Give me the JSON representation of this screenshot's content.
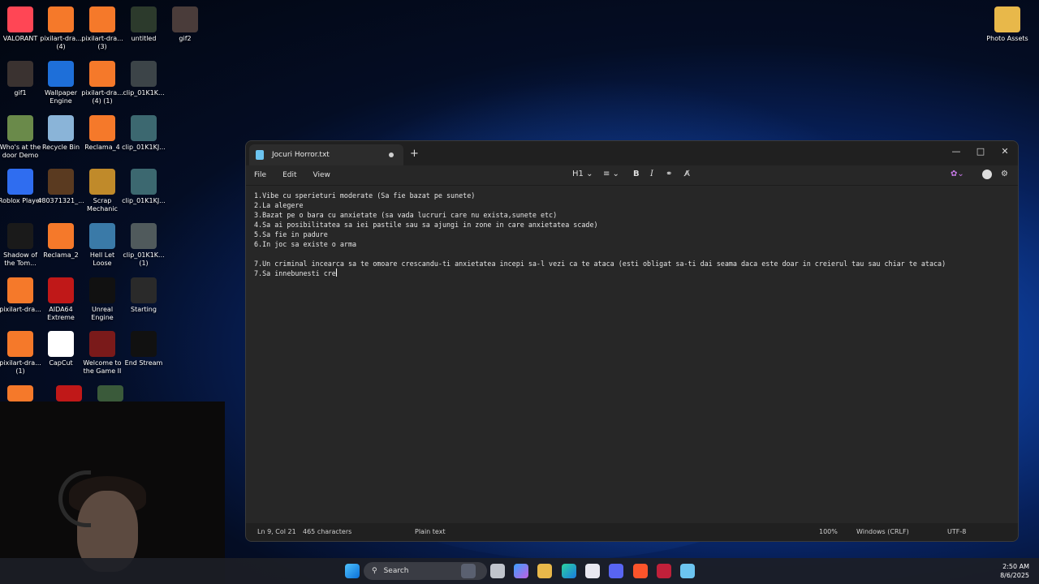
{
  "desktop": {
    "icons": [
      {
        "label": "VALORANT",
        "icon": "valorant-icon",
        "color": "#ff4655"
      },
      {
        "label": "pixilart-dra...\n(4)",
        "icon": "blender-icon",
        "color": "#f5792a"
      },
      {
        "label": "pixilart-dra...\n(3)",
        "icon": "blender-icon",
        "color": "#f5792a"
      },
      {
        "label": "untitled",
        "icon": "video-thumb-icon",
        "color": "#2c3a2c"
      },
      {
        "label": "gif2",
        "icon": "image-thumb-icon",
        "color": "#4a3c3a"
      },
      {
        "label": "gif1",
        "icon": "image-thumb-icon",
        "color": "#3a3230"
      },
      {
        "label": "Wallpaper\nEngine",
        "icon": "wallpaper-engine-icon",
        "color": "#1e6fd9"
      },
      {
        "label": "pixilart-dra...\n(4) (1)",
        "icon": "blender-icon",
        "color": "#f5792a"
      },
      {
        "label": "clip_01K1K...",
        "icon": "video-thumb-icon",
        "color": "#3c4448"
      },
      {
        "label": "Who's at the\ndoor Demo",
        "icon": "game-icon",
        "color": "#6a8a4a"
      },
      {
        "label": "Recycle Bin",
        "icon": "recycle-bin-icon",
        "color": "#8ab4d8"
      },
      {
        "label": "Reclama_4",
        "icon": "blender-icon",
        "color": "#f5792a"
      },
      {
        "label": "clip_01K1KJ...",
        "icon": "video-thumb-icon",
        "color": "#3c6870"
      },
      {
        "label": "Roblox Player",
        "icon": "roblox-icon",
        "color": "#2f6df0"
      },
      {
        "label": "480371321_...",
        "icon": "image-thumb-icon",
        "color": "#5a3a20"
      },
      {
        "label": "Scrap\nMechanic",
        "icon": "game-icon",
        "color": "#c08a2a"
      },
      {
        "label": "clip_01K1KJ...",
        "icon": "video-thumb-icon",
        "color": "#3c6870"
      },
      {
        "label": "Shadow of\nthe Tom...",
        "icon": "game-icon",
        "color": "#1a1a1a"
      },
      {
        "label": "Reclama_2",
        "icon": "blender-icon",
        "color": "#f5792a"
      },
      {
        "label": "Hell Let\nLoose",
        "icon": "game-icon",
        "color": "#3a7aa8"
      },
      {
        "label": "clip_01K1K...\n(1)",
        "icon": "video-thumb-icon",
        "color": "#505a5c"
      },
      {
        "label": "pixilart-dra...",
        "icon": "blender-icon",
        "color": "#f5792a"
      },
      {
        "label": "AIDA64\nExtreme",
        "icon": "aida64-icon",
        "color": "#c01818"
      },
      {
        "label": "Unreal\nEngine",
        "icon": "unreal-engine-icon",
        "color": "#111111"
      },
      {
        "label": "Starting",
        "icon": "video-thumb-icon",
        "color": "#2a2a2a"
      },
      {
        "label": "pixilart-dra...\n(1)",
        "icon": "blender-icon",
        "color": "#f5792a"
      },
      {
        "label": "CapCut",
        "icon": "capcut-icon",
        "color": "#ffffff"
      },
      {
        "label": "Welcome to\nthe Game II",
        "icon": "game-icon",
        "color": "#7a1a1a"
      },
      {
        "label": "End Stream",
        "icon": "video-thumb-icon",
        "color": "#111111"
      },
      {
        "label": "Photo Assets",
        "icon": "folder-icon",
        "color": "#e8b84a"
      }
    ]
  },
  "notepad": {
    "tab_title": "Jocuri Horror.txt",
    "menu": [
      "File",
      "Edit",
      "View"
    ],
    "heading_label": "H1",
    "lines": [
      "1.Vibe cu sperieturi moderate (Sa fie bazat pe sunete)",
      "2.La alegere",
      "3.Bazat pe o bara cu anxietate (sa vada lucruri care nu exista,sunete etc)",
      "4.Sa ai posibilitatea sa iei pastile sau sa ajungi in zone in care anxietatea scade)",
      "5.Sa fie in padure",
      "6.In joc sa existe o arma",
      "",
      "7.Un criminal incearca sa te omoare crescandu-ti anxietatea incepi sa-l vezi ca te ataca (esti obligat sa-ti dai seama daca este doar in creierul tau sau chiar te ataca)",
      "7.Sa innebunesti cre"
    ],
    "status": {
      "position": "Ln 9, Col 21",
      "characters": "465 characters",
      "format": "Plain text",
      "zoom": "100%",
      "line_endings": "Windows (CRLF)",
      "encoding": "UTF-8"
    }
  },
  "taskbar": {
    "search_label": "Search",
    "time": "2:50 AM",
    "date": "8/6/2025"
  }
}
